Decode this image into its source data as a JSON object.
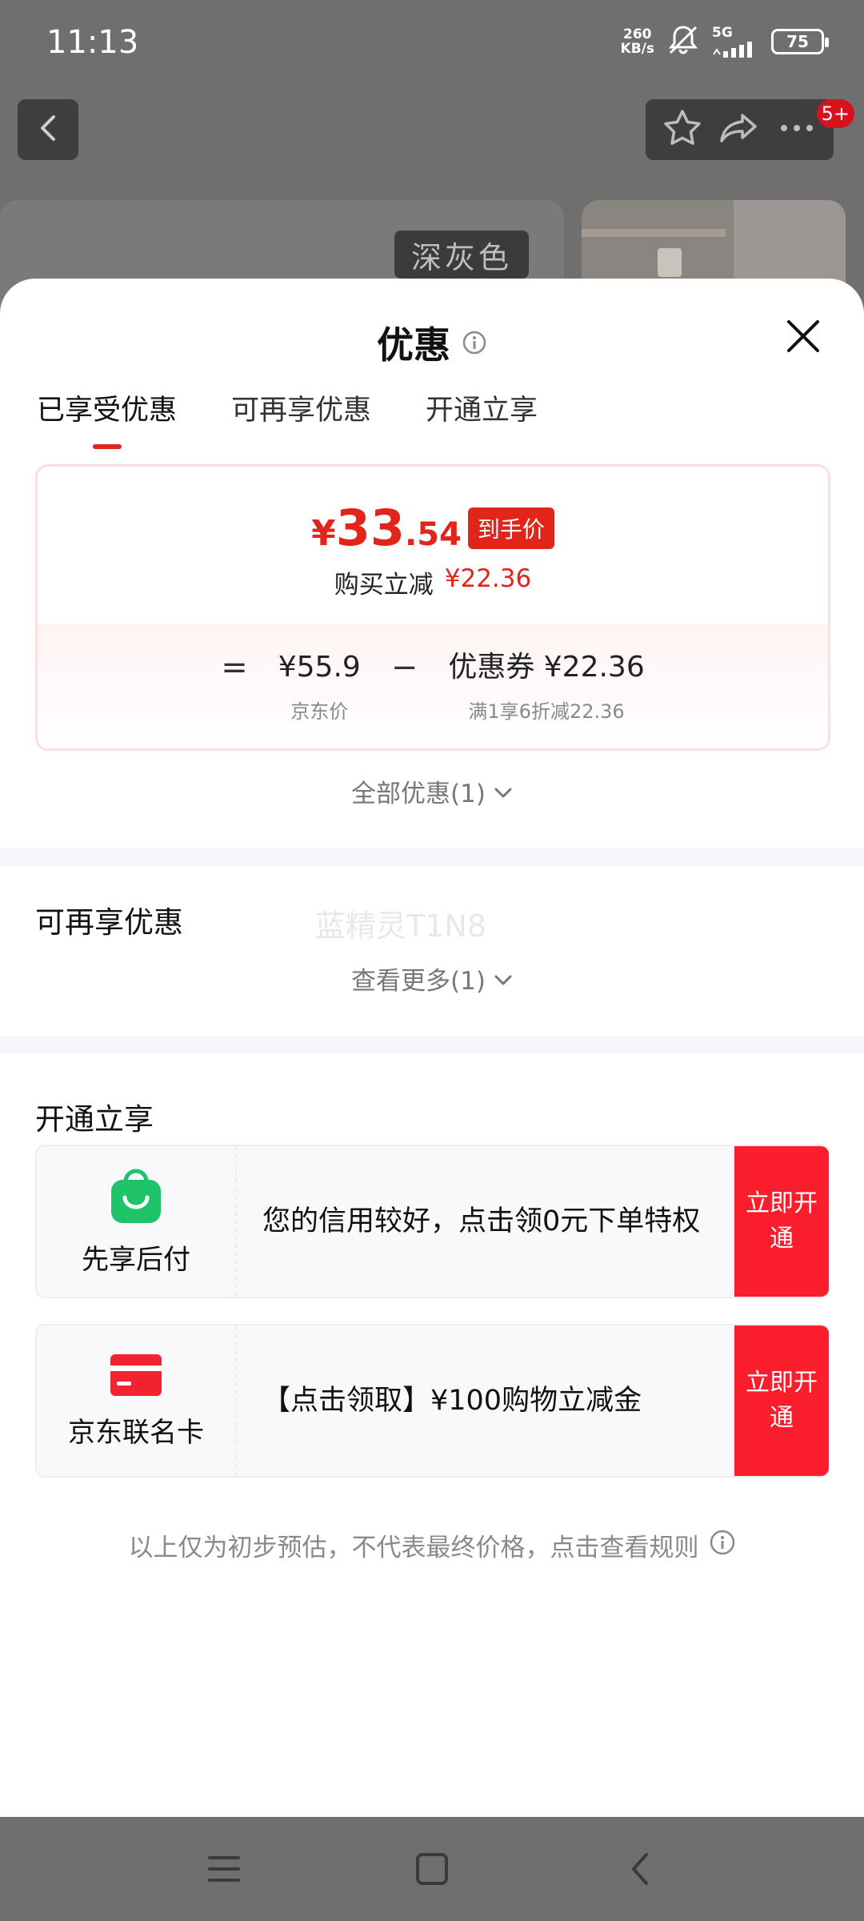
{
  "status_bar": {
    "time": "11:13",
    "net_speed_value": "260",
    "net_speed_unit": "KB/s",
    "network": "5G",
    "battery": "75"
  },
  "background": {
    "badge": "5+",
    "color_label": "深灰色"
  },
  "sheet": {
    "title": "优惠",
    "tabs": [
      {
        "label": "已享受优惠",
        "active": true
      },
      {
        "label": "可再享优惠",
        "active": false
      },
      {
        "label": "开通立享",
        "active": false
      }
    ],
    "price": {
      "yen": "¥",
      "integer": "33",
      "decimal": ".54",
      "tag": "到手价",
      "reduce_label": "购买立减",
      "reduce_amount": "¥22.36"
    },
    "formula": {
      "equals": "=",
      "minus": "−",
      "base_value": "¥55.9",
      "base_caption": "京东价",
      "coupon_value": "优惠券 ¥22.36",
      "coupon_caption": "满1享6折减22.36"
    },
    "all_offers": "全部优惠(1)",
    "section_more": {
      "title": "可再享优惠",
      "watermark": "蓝精灵T1N8",
      "see_more": "查看更多(1)"
    },
    "section_open": {
      "title": "开通立享",
      "offers": [
        {
          "name": "先享后付",
          "icon": "green-shopping-bag-icon",
          "text": "您的信用较好，点击领0元下单特权",
          "button": "立即开通"
        },
        {
          "name": "京东联名卡",
          "icon": "red-credit-card-icon",
          "text": "【点击领取】¥100购物立减金",
          "button": "立即开通"
        }
      ]
    },
    "disclaimer": "以上仅为初步预估，不代表最终价格，点击查看规则"
  },
  "colors": {
    "accent": "#e1251b",
    "button_red": "#fa1e2d",
    "green": "#1fc36a"
  }
}
